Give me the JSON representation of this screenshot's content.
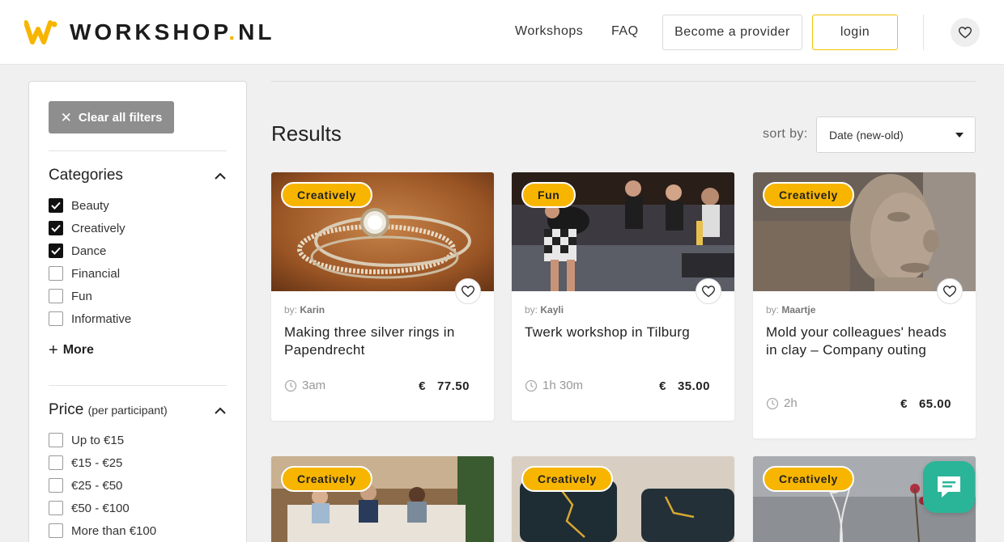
{
  "brand": {
    "name": "WORKSHOP",
    "dot": ".",
    "tld": "NL",
    "accent": "#f7b500"
  },
  "nav": {
    "workshops": "Workshops",
    "faq": "FAQ",
    "provider": "Become a provider",
    "login": "login"
  },
  "sidebar": {
    "clear": "Clear all filters",
    "categories_title": "Categories",
    "categories": [
      {
        "label": "Beauty",
        "checked": true
      },
      {
        "label": "Creatively",
        "checked": true
      },
      {
        "label": "Dance",
        "checked": true
      },
      {
        "label": "Financial",
        "checked": false
      },
      {
        "label": "Fun",
        "checked": false
      },
      {
        "label": "Informative",
        "checked": false
      }
    ],
    "more": "More",
    "price_title": "Price",
    "price_sub": "(per participant)",
    "prices": [
      {
        "label": "Up to €15",
        "checked": false
      },
      {
        "label": "€15 - €25",
        "checked": false
      },
      {
        "label": "€25 - €50",
        "checked": false
      },
      {
        "label": "€50 - €100",
        "checked": false
      },
      {
        "label": "More than €100",
        "checked": false
      }
    ]
  },
  "main": {
    "results": "Results",
    "sort_label": "sort by:",
    "sort_value": "Date (new-old)",
    "cards": [
      {
        "badge": "Creatively",
        "by_prefix": "by:",
        "author": "Karin",
        "title": "Making three silver rings in Papendrecht",
        "duration": "3am",
        "currency": "€",
        "price": "77.50"
      },
      {
        "badge": "Fun",
        "by_prefix": "by:",
        "author": "Kayli",
        "title": "Twerk workshop in Tilburg",
        "duration": "1h 30m",
        "currency": "€",
        "price": "35.00"
      },
      {
        "badge": "Creatively",
        "by_prefix": "by:",
        "author": "Maartje",
        "title": "Mold your colleagues' heads in clay – Company outing",
        "duration": "2h",
        "currency": "€",
        "price": "65.00"
      },
      {
        "badge": "Creatively"
      },
      {
        "badge": "Creatively"
      },
      {
        "badge": "Creatively"
      }
    ]
  }
}
